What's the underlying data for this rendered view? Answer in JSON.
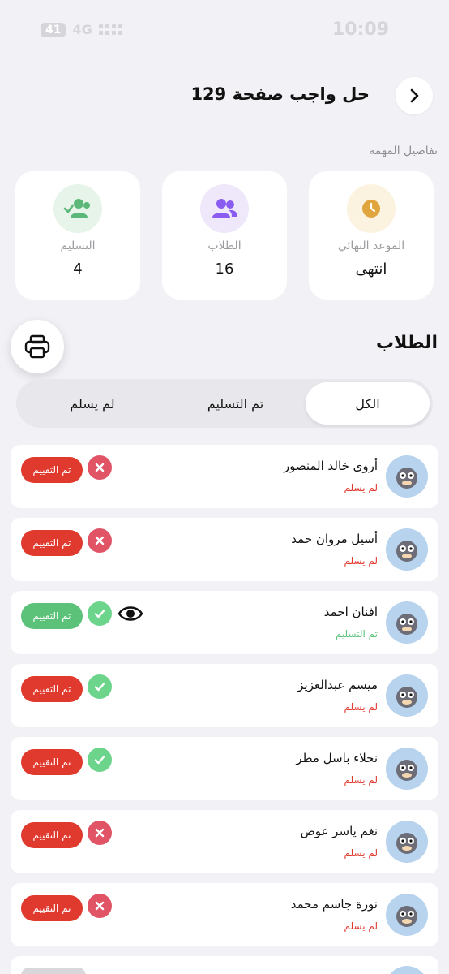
{
  "status_bar": {
    "time": "10:09",
    "network": "4G",
    "battery": "41"
  },
  "header": {
    "title": "حل واجب صفحة 129",
    "back_icon": "chevron-right-icon"
  },
  "details": {
    "section_label": "تفاصيل المهمة",
    "stats": [
      {
        "label": "الموعد النهائي",
        "value": "انتهى",
        "icon": "clock-icon",
        "color": "#e0a53c",
        "bg": "#fbf3df"
      },
      {
        "label": "الطلاب",
        "value": "16",
        "icon": "users-icon",
        "color": "#8b5cf0",
        "bg": "#efe8fb"
      },
      {
        "label": "التسليم",
        "value": "4",
        "icon": "users-check-icon",
        "color": "#5cb879",
        "bg": "#e6f4ea"
      }
    ]
  },
  "students": {
    "title": "الطلاب",
    "tabs": [
      "الكل",
      "تم التسليم",
      "لم يسلم"
    ],
    "active_tab": "الكل",
    "grade_label": "تم التقييم",
    "list": [
      {
        "name": "أروى خالد المنصور",
        "status": "لم يسلم",
        "submitted": false,
        "check": false,
        "eye": false
      },
      {
        "name": "أسيل مروان حمد",
        "status": "لم يسلم",
        "submitted": false,
        "check": false,
        "eye": false
      },
      {
        "name": "افنان احمد",
        "status": "تم التسليم",
        "submitted": true,
        "check": true,
        "eye": true
      },
      {
        "name": "ميسم عبدالعزيز",
        "status": "لم يسلم",
        "submitted": false,
        "check": true,
        "eye": false
      },
      {
        "name": "نجلاء باسل مطر",
        "status": "لم يسلم",
        "submitted": false,
        "check": true,
        "eye": false
      },
      {
        "name": "نغم ياسر عوض",
        "status": "لم يسلم",
        "submitted": false,
        "check": false,
        "eye": false
      },
      {
        "name": "نورة جاسم محمد",
        "status": "لم يسلم",
        "submitted": false,
        "check": false,
        "eye": false
      }
    ]
  },
  "colors": {
    "red": "#e03a2f",
    "green": "#5cc27a",
    "pink_mark": "#e05466",
    "green_mark": "#6dd48c"
  }
}
